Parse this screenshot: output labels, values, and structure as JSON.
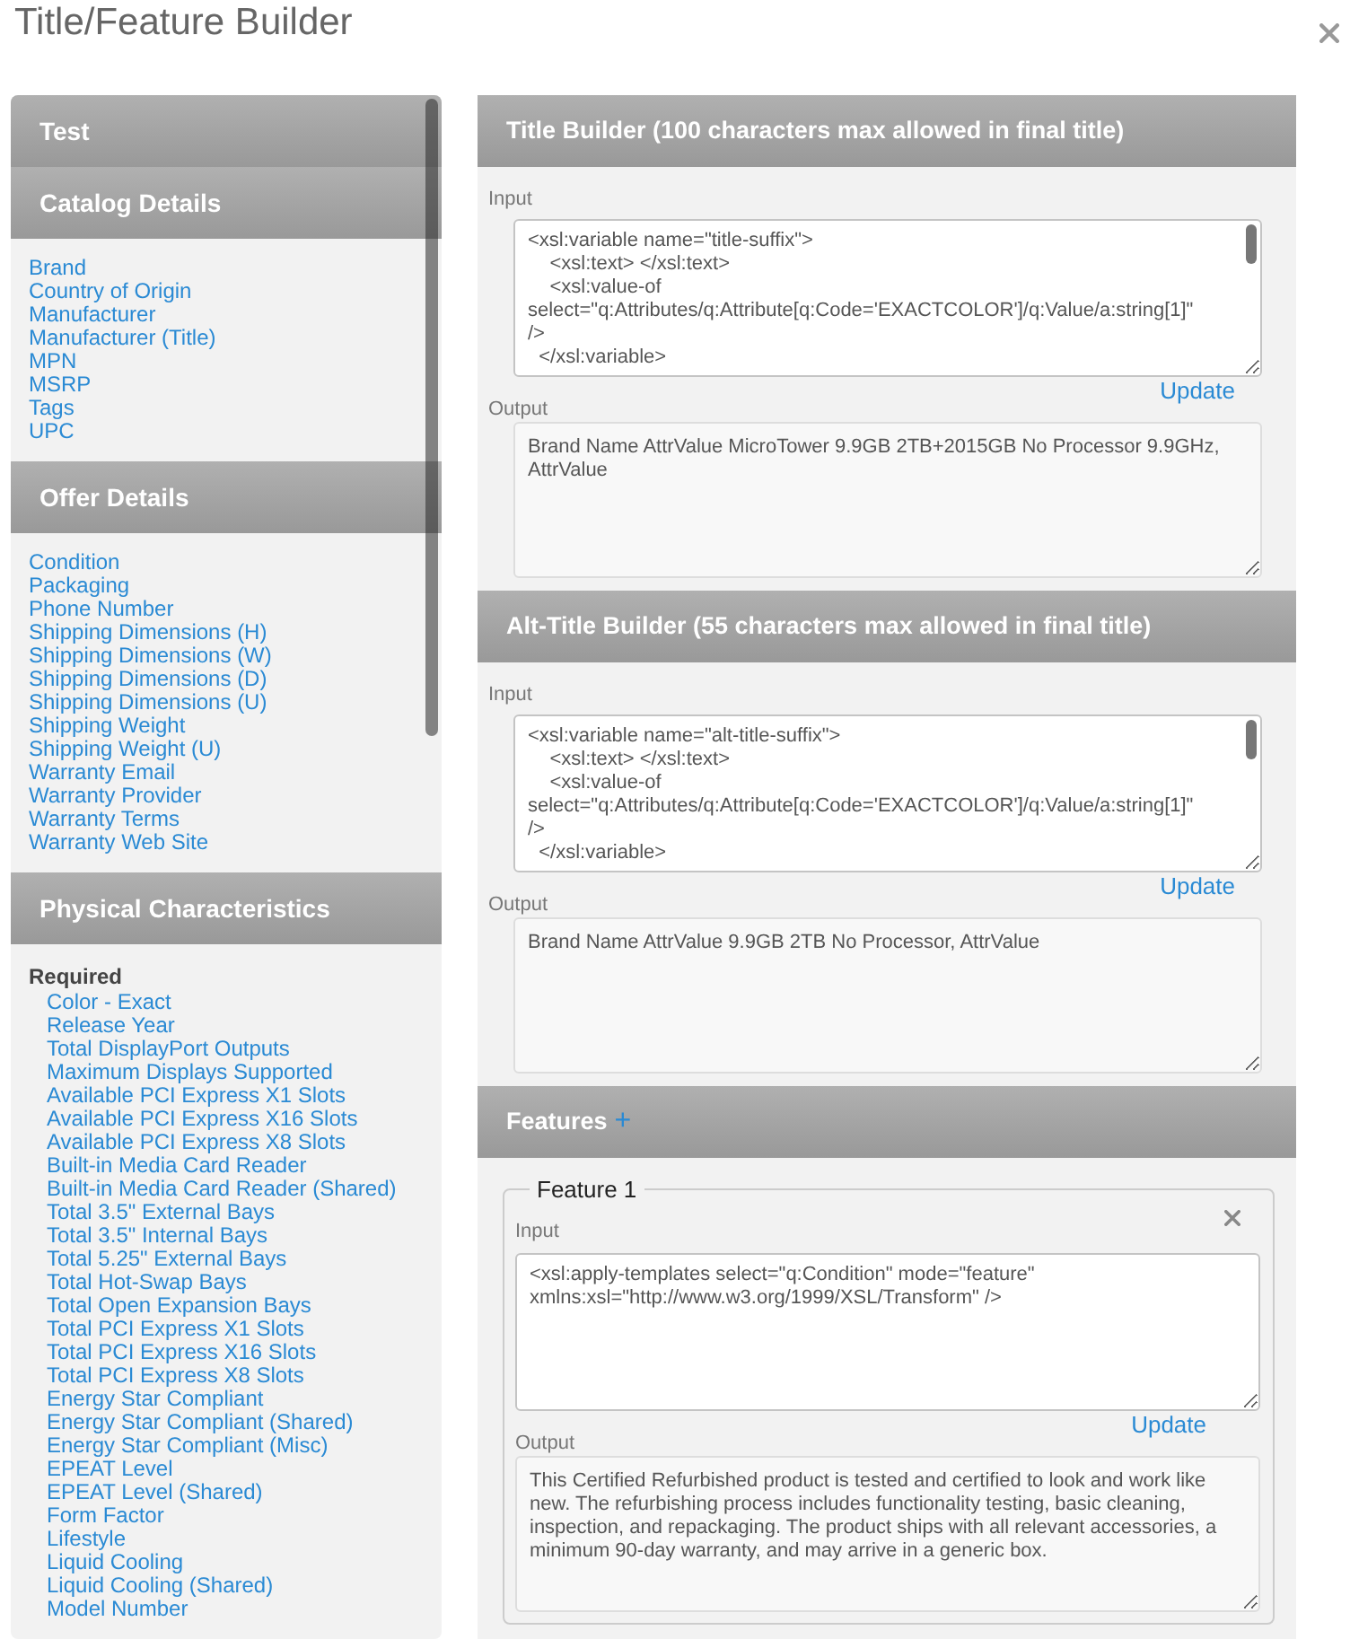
{
  "modal": {
    "title": "Title/Feature Builder"
  },
  "sidebar": {
    "sections": [
      {
        "title": "Test"
      },
      {
        "title": "Catalog Details",
        "items": [
          "Brand",
          "Country of Origin",
          "Manufacturer",
          "Manufacturer (Title)",
          "MPN",
          "MSRP",
          "Tags",
          "UPC"
        ]
      },
      {
        "title": "Offer Details",
        "items": [
          "Condition",
          "Packaging",
          "Phone Number",
          "Shipping Dimensions (H)",
          "Shipping Dimensions (W)",
          "Shipping Dimensions (D)",
          "Shipping Dimensions (U)",
          "Shipping Weight",
          "Shipping Weight (U)",
          "Warranty Email",
          "Warranty Provider",
          "Warranty Terms",
          "Warranty Web Site"
        ]
      },
      {
        "title": "Physical Characteristics",
        "groups": [
          {
            "heading": "Required",
            "items": [
              "Color - Exact",
              "Release Year",
              "Total DisplayPort Outputs",
              "Maximum Displays Supported",
              "Available PCI Express X1 Slots",
              "Available PCI Express X16 Slots",
              "Available PCI Express X8 Slots",
              "Built-in Media Card Reader",
              "Built-in Media Card Reader (Shared)",
              "Total 3.5\" External Bays",
              "Total 3.5\" Internal Bays",
              "Total 5.25\" External Bays",
              "Total Hot-Swap Bays",
              "Total Open Expansion Bays",
              "Total PCI Express X1 Slots",
              "Total PCI Express X16 Slots",
              "Total PCI Express X8 Slots",
              "Energy Star Compliant",
              "Energy Star Compliant (Shared)",
              "Energy Star Compliant (Misc)",
              "EPEAT Level",
              "EPEAT Level (Shared)",
              "Form Factor",
              "Lifestyle",
              "Liquid Cooling",
              "Liquid Cooling (Shared)",
              "Model Number"
            ]
          }
        ]
      }
    ]
  },
  "builders": [
    {
      "title": "Title Builder (100 characters max allowed in final title)",
      "input_label": "Input",
      "input": "<xsl:variable name=\"title-suffix\">\n    <xsl:text> </xsl:text>\n    <xsl:value-of\nselect=\"q:Attributes/q:Attribute[q:Code='EXACTCOLOR']/q:Value/a:string[1]\"\n/>\n  </xsl:variable>",
      "update_label": "Update",
      "output_label": "Output",
      "output": "Brand Name AttrValue MicroTower 9.9GB 2TB+2015GB No Processor 9.9GHz, AttrValue"
    },
    {
      "title": "Alt-Title Builder (55 characters max allowed in final title)",
      "input_label": "Input",
      "input": "<xsl:variable name=\"alt-title-suffix\">\n    <xsl:text> </xsl:text>\n    <xsl:value-of\nselect=\"q:Attributes/q:Attribute[q:Code='EXACTCOLOR']/q:Value/a:string[1]\"\n/>\n  </xsl:variable>",
      "update_label": "Update",
      "output_label": "Output",
      "output": "Brand Name AttrValue 9.9GB 2TB No Processor, AttrValue"
    }
  ],
  "features": {
    "title": "Features",
    "add_label": "+",
    "items": [
      {
        "legend": "Feature 1",
        "input_label": "Input",
        "input": "<xsl:apply-templates select=\"q:Condition\" mode=\"feature\"\nxmlns:xsl=\"http://www.w3.org/1999/XSL/Transform\" />",
        "update_label": "Update",
        "output_label": "Output",
        "output": "This Certified Refurbished product is tested and certified to look and work like new. The refurbishing process includes functionality testing, basic cleaning, inspection, and repackaging. The product ships with all relevant accessories, a minimum 90-day warranty, and may arrive in a generic box."
      }
    ]
  }
}
